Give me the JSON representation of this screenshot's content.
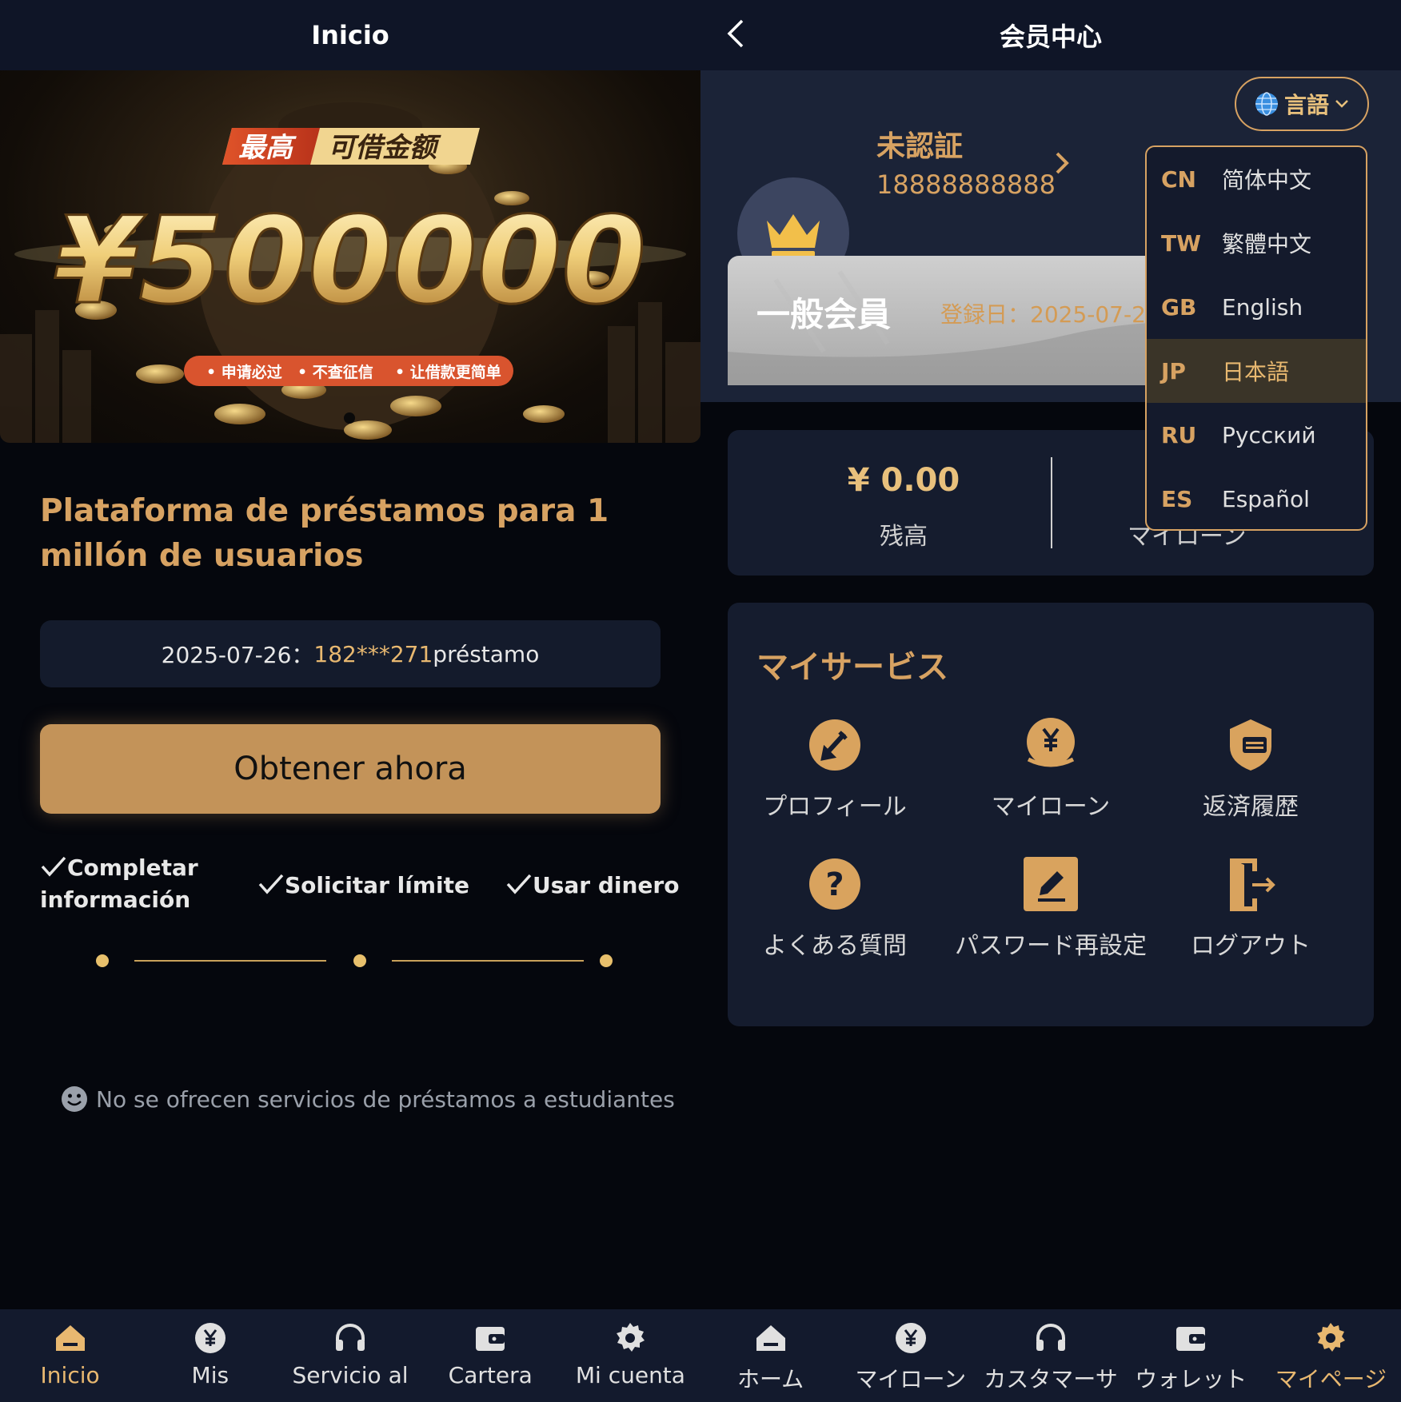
{
  "left": {
    "header": {
      "title": "Inicio"
    },
    "banner": {
      "tag_left": "最高",
      "tag_right": "可借金额",
      "amount": "¥500000",
      "features": [
        "• 申请必过",
        "• 不查征信",
        "• 让借款更简单"
      ]
    },
    "headline": "Plataforma de préstamos para 1 millón de usuarios",
    "ticker": {
      "date": "2025-07-26：",
      "masked_phone": "182***271",
      "suffix": " préstamo"
    },
    "cta_label": "Obtener ahora",
    "steps": [
      "Completar información",
      "Solicitar límite",
      "Usar dinero"
    ],
    "notice": "No se ofrecen servicios de préstamos a estudiantes",
    "tabs": [
      {
        "label": "Inicio",
        "icon": "home-icon",
        "active": true
      },
      {
        "label": "Mis",
        "icon": "yen-icon",
        "active": false
      },
      {
        "label": "Servicio al",
        "icon": "headset-icon",
        "active": false
      },
      {
        "label": "Cartera",
        "icon": "wallet-icon",
        "active": false
      },
      {
        "label": "Mi cuenta",
        "icon": "gear-icon",
        "active": false
      }
    ]
  },
  "right": {
    "header": {
      "title": "会员中心"
    },
    "language_button": "言語",
    "profile": {
      "status": "未認証",
      "phone": "18888888888"
    },
    "level": {
      "name": "一般会員",
      "registered": "登録日：2025-07-2"
    },
    "balance": {
      "amount": "¥ 0.00",
      "label": "残高",
      "loan_label": "マイローン"
    },
    "services": {
      "title": "マイサービス",
      "items": [
        {
          "label": "プロフィール",
          "icon": "edit-circle-icon"
        },
        {
          "label": "マイローン",
          "icon": "yen-hand-icon"
        },
        {
          "label": "返済履歴",
          "icon": "shield-list-icon"
        },
        {
          "label": "よくある質問",
          "icon": "question-icon"
        },
        {
          "label": "パスワード再設定",
          "icon": "pencil-box-icon"
        },
        {
          "label": "ログアウト",
          "icon": "logout-icon"
        }
      ]
    },
    "languages": [
      {
        "code": "CN",
        "name": "简体中文",
        "selected": false
      },
      {
        "code": "TW",
        "name": "繁體中文",
        "selected": false
      },
      {
        "code": "GB",
        "name": "English",
        "selected": false
      },
      {
        "code": "JP",
        "name": "日本語",
        "selected": true
      },
      {
        "code": "RU",
        "name": "Русский",
        "selected": false
      },
      {
        "code": "ES",
        "name": "Español",
        "selected": false
      }
    ],
    "tabs": [
      {
        "label": "ホーム",
        "icon": "home-icon",
        "active": false
      },
      {
        "label": "マイローン",
        "icon": "yen-icon",
        "active": false
      },
      {
        "label": "カスタマーサ",
        "icon": "headset-icon",
        "active": false
      },
      {
        "label": "ウォレット",
        "icon": "wallet-icon",
        "active": false
      },
      {
        "label": "マイページ",
        "icon": "gear-icon",
        "active": true
      }
    ]
  },
  "colors": {
    "accent_gold": "#d7a262",
    "cta_gold": "#c39359",
    "background": "#05070d",
    "card": "#151c2e",
    "header": "#0f1527"
  }
}
